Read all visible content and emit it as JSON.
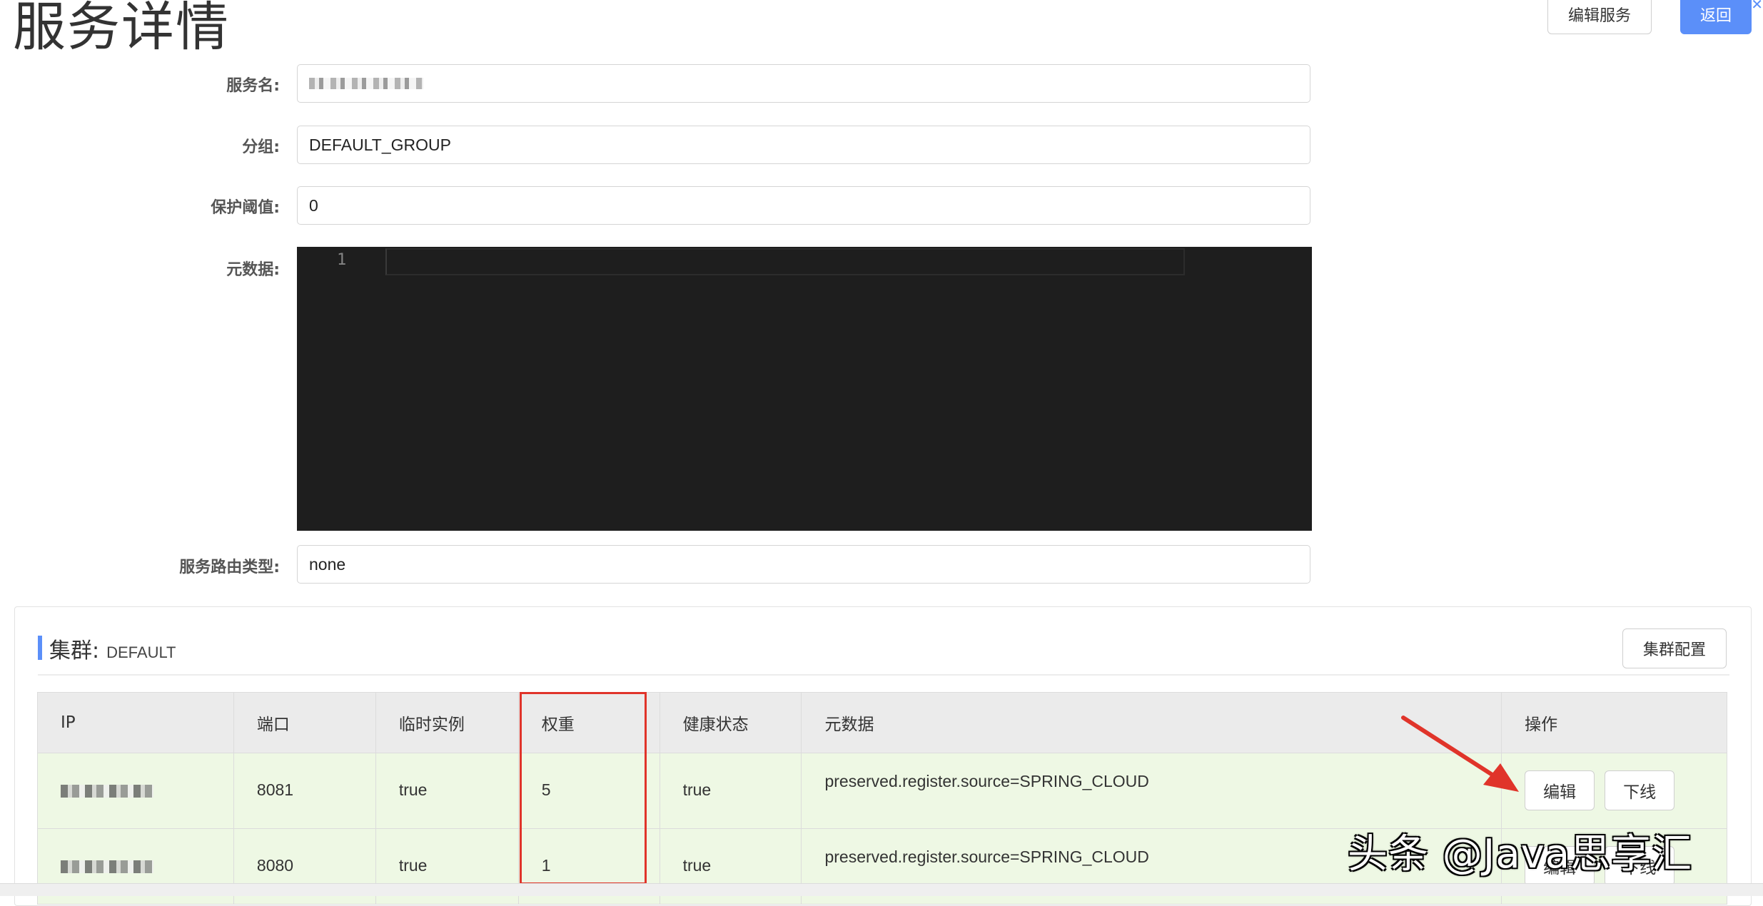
{
  "page": {
    "title": "服务详情"
  },
  "header_buttons": {
    "edit_service": "编辑服务",
    "back": "返回"
  },
  "form": {
    "service_name": {
      "label": "服务名:",
      "value": ""
    },
    "group": {
      "label": "分组:",
      "value": "DEFAULT_GROUP"
    },
    "protect_threshold": {
      "label": "保护阈值:",
      "value": "0"
    },
    "metadata": {
      "label": "元数据:",
      "line_number": "1"
    },
    "route_type": {
      "label": "服务路由类型:",
      "value": "none"
    }
  },
  "cluster": {
    "title": "集群:",
    "name": "DEFAULT",
    "config_button": "集群配置",
    "table": {
      "headers": [
        "IP",
        "端口",
        "临时实例",
        "权重",
        "健康状态",
        "元数据",
        "操作"
      ],
      "rows": [
        {
          "ip": "",
          "port": "8081",
          "ephemeral": "true",
          "weight": "5",
          "healthy": "true",
          "metadata": "preserved.register.source=SPRING_CLOUD",
          "edit": "编辑",
          "offline": "下线"
        },
        {
          "ip": "",
          "port": "8080",
          "ephemeral": "true",
          "weight": "1",
          "healthy": "true",
          "metadata": "preserved.register.source=SPRING_CLOUD",
          "edit": "编辑",
          "offline": "下线"
        }
      ]
    }
  },
  "annotations": {
    "highlight_color": "#e0342a",
    "highlighted_column": "权重"
  },
  "watermark": "头条 @Java思享汇",
  "colors": {
    "primary": "#5b8ff9",
    "row_healthy_bg": "#eef8e4",
    "editor_bg": "#1e1e1e"
  }
}
